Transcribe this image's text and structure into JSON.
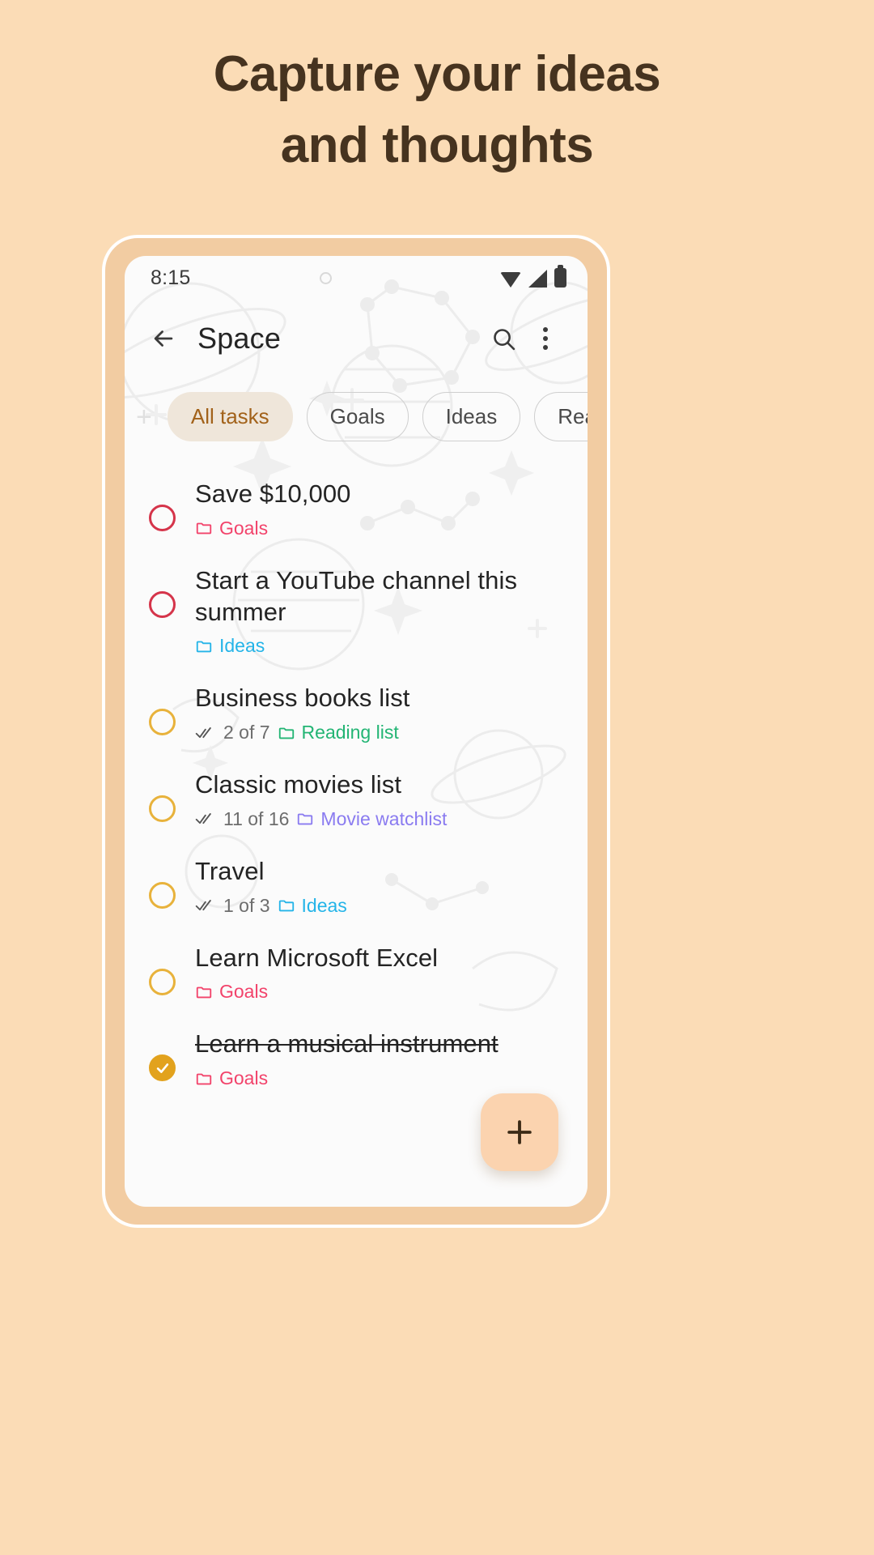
{
  "headline": {
    "line1": "Capture your ideas",
    "line2": "and thoughts"
  },
  "colors": {
    "page_background": "#FBDCB6",
    "phone_frame": "#F2CCA2",
    "screen": "#FBFBFB",
    "headline_text": "#46331F",
    "chip_selected_bg": "#EFE6DA",
    "chip_selected_text": "#A2621A",
    "circle_high": "#D5344A",
    "circle_medium": "#E8B23B",
    "circle_done": "#E2A21D",
    "fab_bg": "#FBD3AF",
    "fab_icon": "#3B2A16",
    "folder_goals": "#F2436B",
    "folder_ideas": "#24B4E8",
    "folder_reading": "#23B574",
    "folder_movie": "#8A7BF0"
  },
  "statusbar": {
    "time": "8:15",
    "icons": [
      "wifi-icon",
      "signal-icon",
      "battery-icon"
    ]
  },
  "appbar": {
    "back_icon": "back-arrow-icon",
    "title": "Space",
    "search_icon": "search-icon",
    "overflow_icon": "overflow-menu-icon"
  },
  "chips": {
    "add_icon": "add-chip-icon",
    "items": [
      {
        "label": "All tasks",
        "selected": true
      },
      {
        "label": "Goals",
        "selected": false
      },
      {
        "label": "Ideas",
        "selected": false
      },
      {
        "label": "Reading list",
        "selected": false
      }
    ]
  },
  "tasks": [
    {
      "title": "Save $10,000",
      "priority": "high",
      "completed": false,
      "progress": "",
      "folder": "Goals",
      "folder_color": "#F2436B"
    },
    {
      "title": "Start a YouTube channel this summer",
      "priority": "high",
      "completed": false,
      "progress": "",
      "folder": "Ideas",
      "folder_color": "#24B4E8"
    },
    {
      "title": "Business books list",
      "priority": "medium",
      "completed": false,
      "progress": "2 of 7",
      "folder": "Reading list",
      "folder_color": "#23B574"
    },
    {
      "title": "Classic movies list",
      "priority": "medium",
      "completed": false,
      "progress": "11 of 16",
      "folder": "Movie watchlist",
      "folder_color": "#8A7BF0"
    },
    {
      "title": "Travel",
      "priority": "medium",
      "completed": false,
      "progress": "1 of 3",
      "folder": "Ideas",
      "folder_color": "#24B4E8"
    },
    {
      "title": "Learn Microsoft Excel",
      "priority": "medium",
      "completed": false,
      "progress": "",
      "folder": "Goals",
      "folder_color": "#F2436B"
    },
    {
      "title": "Learn a musical instrument",
      "priority": "medium",
      "completed": true,
      "progress": "",
      "folder": "Goals",
      "folder_color": "#F2436B"
    }
  ],
  "fab": {
    "icon": "plus-icon",
    "label": "Add task"
  }
}
